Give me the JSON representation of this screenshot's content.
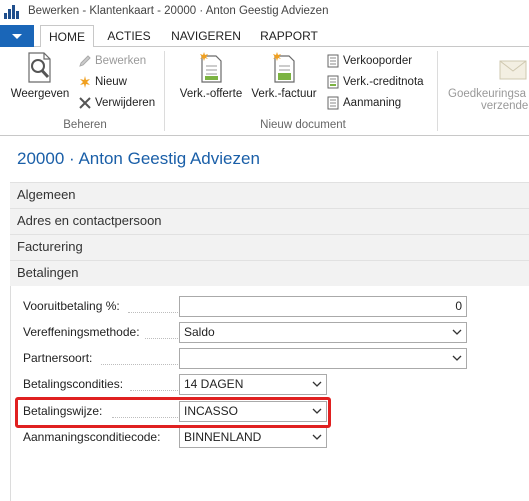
{
  "window": {
    "title": "Bewerken - Klantenkaart - 20000 · Anton Geestig Adviezen"
  },
  "tabs": [
    {
      "label": "HOME",
      "active": true
    },
    {
      "label": "ACTIES",
      "active": false
    },
    {
      "label": "NAVIGEREN",
      "active": false
    },
    {
      "label": "RAPPORT",
      "active": false
    }
  ],
  "ribbon": {
    "beheren": {
      "group_label": "Beheren",
      "weergeven": "Weergeven",
      "bewerken": "Bewerken",
      "nieuw": "Nieuw",
      "verwijderen": "Verwijderen"
    },
    "nieuw_document": {
      "group_label": "Nieuw document",
      "verk_offerte": "Verk.-offerte",
      "verk_factuur": "Verk.-factuur",
      "verkooporder": "Verkooporder",
      "verk_creditnota": "Verk.-creditnota",
      "aanmaning": "Aanmaning"
    },
    "goedkeuring": {
      "line1": "Goedkeuringsa",
      "line2": "verzende"
    }
  },
  "page": {
    "title": "20000 · Anton Geestig Adviezen"
  },
  "sections": {
    "algemeen": "Algemeen",
    "adres": "Adres en contactpersoon",
    "facturering": "Facturering",
    "betalingen": "Betalingen"
  },
  "fields": {
    "vooruitbetaling": {
      "label": "Vooruitbetaling %:",
      "value": "0"
    },
    "vereffeningsmethode": {
      "label": "Vereffeningsmethode:",
      "value": "Saldo"
    },
    "partnersoort": {
      "label": "Partnersoort:",
      "value": ""
    },
    "betalingscondities": {
      "label": "Betalingscondities:",
      "value": "14 DAGEN"
    },
    "betalingswijze": {
      "label": "Betalingswijze:",
      "value": "INCASSO"
    },
    "aanmaningsconditiecode": {
      "label": "Aanmaningsconditiecode:",
      "value": "BINNENLAND"
    }
  },
  "colors": {
    "accent": "#1a66b8",
    "title": "#1a5fa8",
    "highlight": "#e02020"
  }
}
